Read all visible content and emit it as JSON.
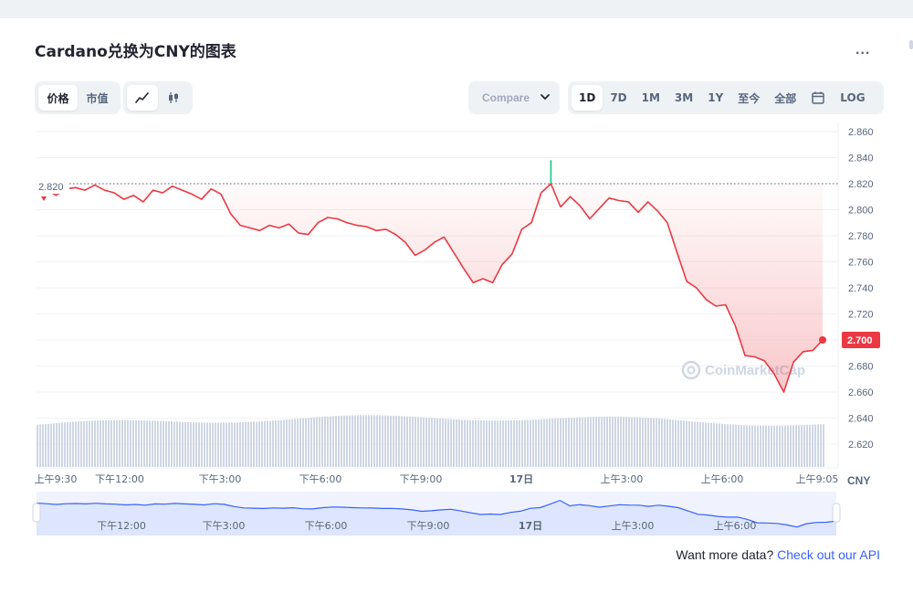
{
  "header": {
    "title": "Cardano兑换为CNY的图表",
    "more_label": "..."
  },
  "toolbar": {
    "view_tabs": [
      "价格",
      "市值"
    ],
    "compare_placeholder": "Compare",
    "ranges": [
      "1D",
      "7D",
      "1M",
      "3M",
      "1Y",
      "至今",
      "全部"
    ],
    "log_label": "LOG",
    "active_range": "1D",
    "active_view": "价格"
  },
  "footer": {
    "text": "Want more data?",
    "link": "Check out our API"
  },
  "watermark": "CoinMarketCap",
  "colors": {
    "line": "#ea3943",
    "spike": "#16c784",
    "volume": "#cfd6e4",
    "nav_fill": "#dde6fd",
    "nav_line": "#3861fb",
    "badge": "#ea3943"
  },
  "chart_data": {
    "type": "line",
    "title": "Cardano兑换为CNY的图表",
    "currency_label": "CNY",
    "ylim": [
      2.6,
      2.87
    ],
    "y_ticks": [
      "2.860",
      "2.840",
      "2.820",
      "2.800",
      "2.780",
      "2.760",
      "2.740",
      "2.720",
      "2.700",
      "2.680",
      "2.660",
      "2.640",
      "2.620"
    ],
    "open_price": 2.82,
    "open_label": "2.820",
    "current_price": 2.7,
    "current_label": "2.700",
    "x_ticks": [
      "上午9:30",
      "下午12:00",
      "下午3:00",
      "下午6:00",
      "下午9:00",
      "17日",
      "上午3:00",
      "上午6:00",
      "上午9:05"
    ],
    "nav_ticks": [
      "下午12:00",
      "下午3:00",
      "下午6:00",
      "下午9:00",
      "17日",
      "上午3:00",
      "上午6:00"
    ],
    "grid": true,
    "series": [
      {
        "values": [
          2.82,
          2.816,
          2.811,
          2.816,
          2.817,
          2.815,
          2.819,
          2.815,
          2.813,
          2.808,
          2.811,
          2.806,
          2.815,
          2.813,
          2.818,
          2.815,
          2.812,
          2.808,
          2.816,
          2.812,
          2.797,
          2.788,
          2.786,
          2.784,
          2.788,
          2.786,
          2.789,
          2.782,
          2.781,
          2.79,
          2.794,
          2.793,
          2.79,
          2.788,
          2.787,
          2.784,
          2.785,
          2.781,
          2.775,
          2.765,
          2.769,
          2.775,
          2.779,
          2.767,
          2.755,
          2.744,
          2.747,
          2.744,
          2.758,
          2.766,
          2.785,
          2.79,
          2.813,
          2.838,
          2.802,
          2.81,
          2.803,
          2.793,
          2.801,
          2.809,
          2.807,
          2.806,
          2.798,
          2.806,
          2.799,
          2.79,
          2.767,
          2.745,
          2.74,
          2.731,
          2.726,
          2.727,
          2.711,
          2.688,
          2.687,
          2.684,
          2.674,
          2.66,
          2.683,
          2.691,
          2.692,
          2.7
        ]
      }
    ],
    "volume_note": "volume bars shown beneath price line, unlabeled"
  }
}
